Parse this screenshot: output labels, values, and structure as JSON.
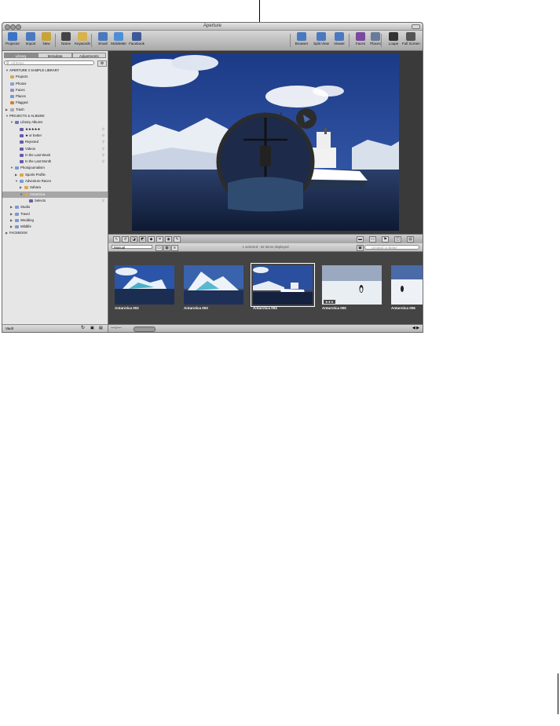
{
  "window": {
    "title": "Aperture"
  },
  "toolbar": {
    "left": [
      {
        "label": "Projector",
        "icon": "info-icon",
        "color": "#3b73c8"
      },
      {
        "label": "Import",
        "icon": "import-arrow-icon",
        "color": "#4a79c0"
      },
      {
        "label": "New",
        "icon": "new-folder-icon",
        "color": "#c9a23a"
      },
      {
        "label": "Name",
        "icon": "name-person-icon",
        "color": "#444444"
      },
      {
        "label": "Keywords",
        "icon": "keywords-tag-icon",
        "color": "#d8b24a"
      },
      {
        "label": "Email",
        "icon": "email-icon",
        "color": "#4a79c0"
      },
      {
        "label": "MobileMe",
        "icon": "mobileme-cloud-icon",
        "color": "#4d8fd6"
      },
      {
        "label": "Facebook",
        "icon": "facebook-icon",
        "color": "#3b5998"
      }
    ],
    "right": [
      {
        "label": "Browser",
        "icon": "browser-grid-icon",
        "color": "#4a79c0"
      },
      {
        "label": "Split View",
        "icon": "split-view-icon",
        "color": "#4a79c0"
      },
      {
        "label": "Viewer",
        "icon": "viewer-icon",
        "color": "#4a79c0"
      },
      {
        "label": "Faces",
        "icon": "faces-icon",
        "color": "#7a4aa0"
      },
      {
        "label": "Places",
        "icon": "places-icon",
        "color": "#6a7a9a"
      },
      {
        "label": "Loupe",
        "icon": "loupe-icon",
        "color": "#333333"
      },
      {
        "label": "Full Screen",
        "icon": "full-screen-icon",
        "color": "#555555"
      }
    ]
  },
  "sidebar": {
    "tabs": [
      "Library",
      "Metadata",
      "Adjustments"
    ],
    "search_placeholder": "All Items",
    "tree": [
      {
        "label": "APERTURE 3 SAMPLE LIBRARY",
        "type": "head",
        "tri": "▼"
      },
      {
        "label": "Projects",
        "icon": "#d9a84a"
      },
      {
        "label": "Photos",
        "icon": "#8aa0c8"
      },
      {
        "label": "Faces",
        "icon": "#9a8ac0"
      },
      {
        "label": "Places",
        "icon": "#7a9ac0"
      },
      {
        "label": "Flagged",
        "icon": "#e07a2a"
      },
      {
        "label": "Trash",
        "icon": "#aaaaaa",
        "tri": "▶"
      },
      {
        "label": "PROJECTS & ALBUMS",
        "type": "head",
        "tri": "▼"
      },
      {
        "label": "Library Albums",
        "icon": "#6a7ab8",
        "tri": "▼",
        "indent": 1
      },
      {
        "label": "★★★★★",
        "icon": "#6a5aa8",
        "indent": 2,
        "mag": true
      },
      {
        "label": "★ or better",
        "icon": "#6a5aa8",
        "indent": 2,
        "mag": true
      },
      {
        "label": "Rejected",
        "icon": "#6a5aa8",
        "indent": 2,
        "mag": true
      },
      {
        "label": "Videos",
        "icon": "#6a5aa8",
        "indent": 2,
        "mag": true
      },
      {
        "label": "In the Last Week",
        "icon": "#6a5aa8",
        "indent": 2,
        "mag": true
      },
      {
        "label": "In the Last Month",
        "icon": "#6a5aa8",
        "indent": 2,
        "mag": true
      },
      {
        "label": "Photojournalism",
        "icon": "#7a9ad0",
        "tri": "▼",
        "indent": 1
      },
      {
        "label": "Sports Profile",
        "icon": "#d9a84a",
        "tri": "▶",
        "indent": 2
      },
      {
        "label": "Adventure Races",
        "icon": "#7a9ad0",
        "tri": "▼",
        "indent": 2
      },
      {
        "label": "Sahara",
        "icon": "#d9a84a",
        "tri": "▶",
        "indent": 3
      },
      {
        "label": "Antarctica",
        "icon": "#d9a84a",
        "tri": "▼",
        "indent": 3,
        "selected": true
      },
      {
        "label": "Selects",
        "icon": "#6a5aa8",
        "indent": 4,
        "mag": true
      },
      {
        "label": "Studio",
        "icon": "#7a9ad0",
        "tri": "▶",
        "indent": 1
      },
      {
        "label": "Travel",
        "icon": "#7a9ad0",
        "tri": "▶",
        "indent": 1
      },
      {
        "label": "Wedding",
        "icon": "#7a9ad0",
        "tri": "▶",
        "indent": 1
      },
      {
        "label": "Wildlife",
        "icon": "#7a9ad0",
        "tri": "▶",
        "indent": 1
      },
      {
        "label": "FACEBOOK",
        "type": "head",
        "tri": "▶"
      }
    ],
    "vault_label": "Vault"
  },
  "browser": {
    "sort": "Manual",
    "status": "1 selected - 62 items displayed",
    "filter_placeholder": "Unrated or Better",
    "thumbs": [
      {
        "caption": "Antarctica 002"
      },
      {
        "caption": "Antarctica 003"
      },
      {
        "caption": "Antarctica 004",
        "selected": true
      },
      {
        "caption": "Antarctica 005",
        "stars": "★★★"
      },
      {
        "caption": "Antarctica 006"
      }
    ]
  }
}
